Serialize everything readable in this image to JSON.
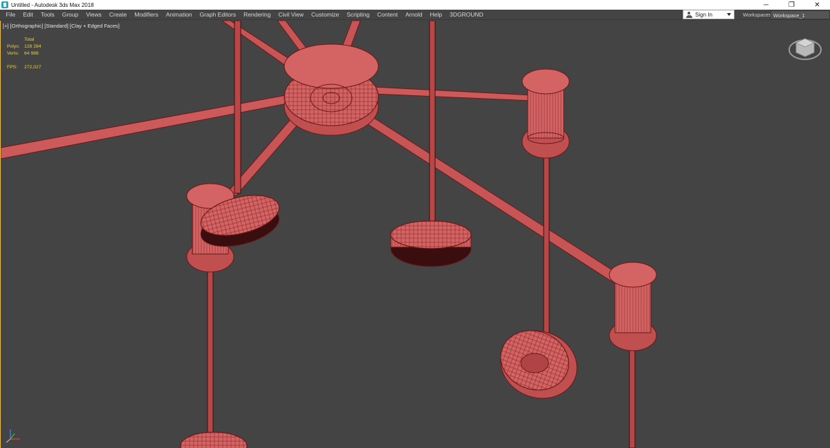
{
  "window": {
    "title": "Untitled - Autodesk 3ds Max 2018",
    "controls": {
      "minimize": "─",
      "restore": "❐",
      "close": "✕"
    }
  },
  "menu": {
    "items": [
      "File",
      "Edit",
      "Tools",
      "Group",
      "Views",
      "Create",
      "Modifiers",
      "Animation",
      "Graph Editors",
      "Rendering",
      "Civil View",
      "Customize",
      "Scripting",
      "Content",
      "Arnold",
      "Help",
      "3DGROUND"
    ],
    "sign_in": "Sign In",
    "workspaces_label": "Workspaces:",
    "workspace_value": "Workspace_1"
  },
  "viewport": {
    "label": "[+] [Orthographic] [Standard] [Clay + Edged Faces]",
    "stats": {
      "total_label": "Total",
      "polys_label": "Polys:",
      "polys_value": "128 284",
      "verts_label": "Verts:",
      "verts_value": "64 988",
      "fps_label": "FPS:",
      "fps_value": "272,027"
    }
  },
  "colors": {
    "ui_background": "#444444",
    "model_fill": "#d06060",
    "model_edge": "#6a1818",
    "stats_text": "#e8d040"
  }
}
